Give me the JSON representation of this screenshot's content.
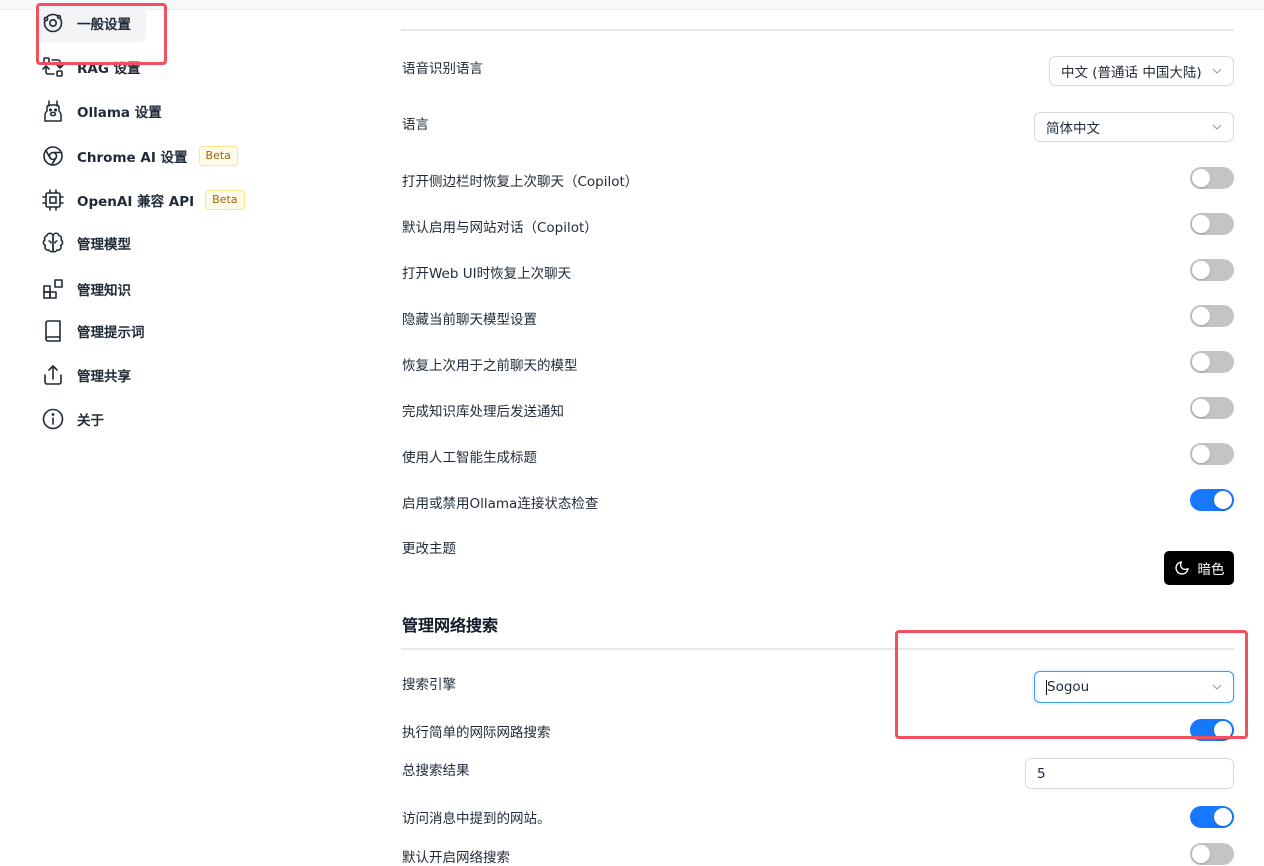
{
  "sidebar": {
    "items": [
      {
        "label": "一般设置",
        "icon": "general-settings-icon"
      },
      {
        "label": "RAG 设置",
        "icon": "rag-icon"
      },
      {
        "label": "Ollama 设置",
        "icon": "llama-icon"
      },
      {
        "label": "Chrome AI 设置",
        "icon": "chrome-icon",
        "badge": "Beta"
      },
      {
        "label": "OpenAI 兼容 API",
        "icon": "cpu-icon",
        "badge": "Beta"
      },
      {
        "label": "管理模型",
        "icon": "brain-icon"
      },
      {
        "label": "管理知识",
        "icon": "blocks-icon"
      },
      {
        "label": "管理提示词",
        "icon": "book-icon"
      },
      {
        "label": "管理共享",
        "icon": "share-icon"
      },
      {
        "label": "关于",
        "icon": "info-icon"
      }
    ]
  },
  "general": {
    "speech_language": {
      "label": "语音识别语言",
      "value": "中文 (普通话 中国大陆)"
    },
    "language": {
      "label": "语言",
      "value": "简体中文"
    },
    "toggles": [
      {
        "label": "打开侧边栏时恢复上次聊天（Copilot）",
        "on": false
      },
      {
        "label": "默认启用与网站对话（Copilot）",
        "on": false
      },
      {
        "label": "打开Web UI时恢复上次聊天",
        "on": false
      },
      {
        "label": "隐藏当前聊天模型设置",
        "on": false
      },
      {
        "label": "恢复上次用于之前聊天的模型",
        "on": false
      },
      {
        "label": "完成知识库处理后发送通知",
        "on": false
      },
      {
        "label": "使用人工智能生成标题",
        "on": false
      },
      {
        "label": "启用或禁用Ollama连接状态检查",
        "on": true
      }
    ],
    "theme": {
      "label": "更改主题",
      "button": "暗色",
      "icon": "moon-icon"
    }
  },
  "web_search": {
    "title": "管理网络搜索",
    "engine": {
      "label": "搜索引擎",
      "value": "Sogou"
    },
    "simple_search": {
      "label": "执行简单的网际网路搜索",
      "on": true
    },
    "total_results": {
      "label": "总搜索结果",
      "value": "5"
    },
    "visit_sites": {
      "label": "访问消息中提到的网站。",
      "on": true
    },
    "default_search": {
      "label": "默认开启网络搜索",
      "on": false
    }
  },
  "colors": {
    "toggle_on": "#1677ff",
    "toggle_off": "#c4c4c4",
    "highlight": "#f0505f",
    "badge_bg": "#fefce8",
    "badge_text": "#a16207"
  }
}
